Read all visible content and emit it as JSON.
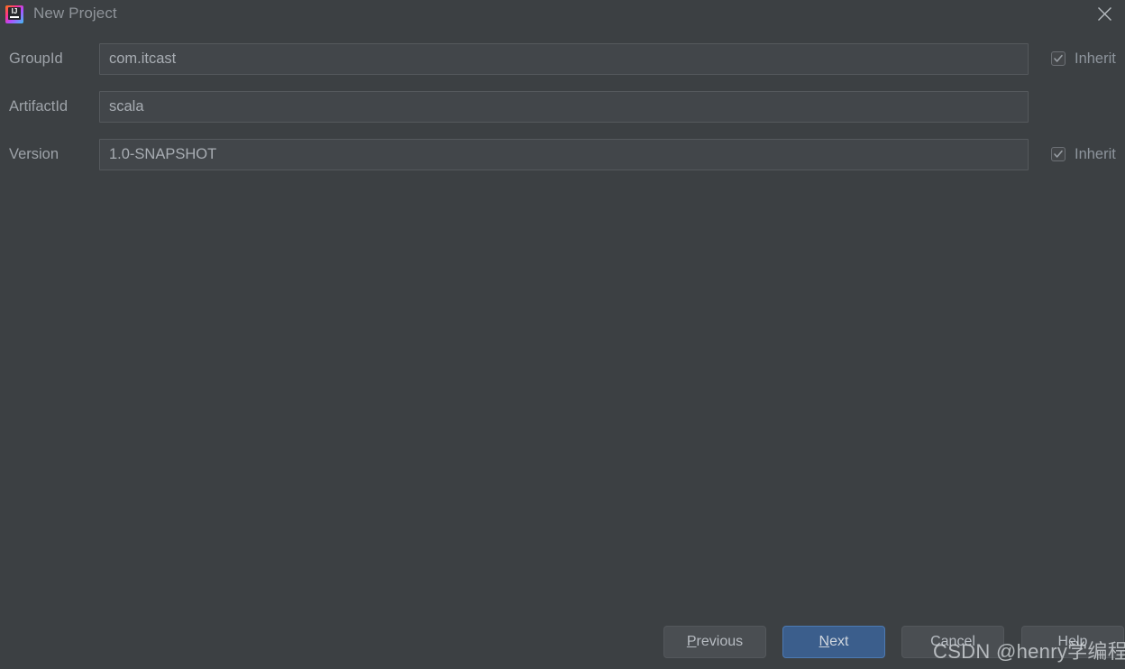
{
  "window": {
    "title": "New Project",
    "logo_icon": "intellij-idea-logo",
    "logo_text": "IJ",
    "close_icon": "close-icon"
  },
  "form": {
    "rows": [
      {
        "label": "GroupId",
        "value": "com.itcast",
        "placeholder": "",
        "checkbox": {
          "label": "Inherit",
          "checked": true
        }
      },
      {
        "label": "ArtifactId",
        "value": "scala",
        "placeholder": "",
        "checkbox": null
      },
      {
        "label": "Version",
        "value": "1.0-SNAPSHOT",
        "placeholder": "",
        "checkbox": {
          "label": "Inherit",
          "checked": true
        }
      }
    ]
  },
  "footer": {
    "buttons": [
      {
        "name": "previous",
        "mnemonic": "P",
        "rest": "revious"
      },
      {
        "name": "next",
        "mnemonic": "N",
        "rest": "ext"
      },
      {
        "name": "cancel",
        "mnemonic": "",
        "rest": "Cancel"
      },
      {
        "name": "help",
        "mnemonic": "",
        "rest": "Help"
      }
    ]
  },
  "watermark": {
    "text": "CSDN @henry学编程"
  },
  "colors": {
    "background": "#3c4043",
    "field_background": "#42464a",
    "field_border": "#55595d",
    "accent_button": "#3b5e8c",
    "text": "#9aa0a6"
  }
}
